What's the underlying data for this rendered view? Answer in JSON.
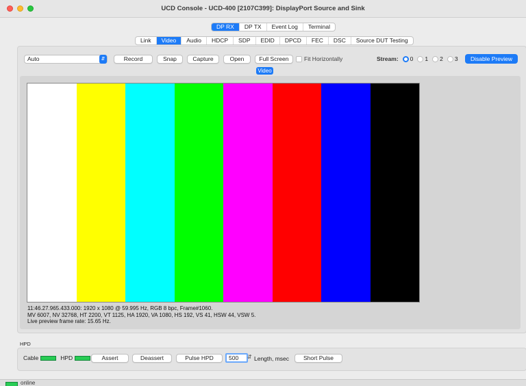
{
  "window": {
    "title": "UCD Console - UCD-400 [2107C399]: DisplayPort Source and Sink"
  },
  "top_tabs": [
    {
      "label": "DP RX",
      "active": true
    },
    {
      "label": "DP TX",
      "active": false
    },
    {
      "label": "Event Log",
      "active": false
    },
    {
      "label": "Terminal",
      "active": false
    }
  ],
  "sub_tabs": [
    {
      "label": "Link",
      "active": false
    },
    {
      "label": "Video",
      "active": true
    },
    {
      "label": "Audio",
      "active": false
    },
    {
      "label": "HDCP",
      "active": false
    },
    {
      "label": "SDP",
      "active": false
    },
    {
      "label": "EDID",
      "active": false
    },
    {
      "label": "DPCD",
      "active": false
    },
    {
      "label": "FEC",
      "active": false
    },
    {
      "label": "DSC",
      "active": false
    },
    {
      "label": "Source DUT Testing",
      "active": false
    }
  ],
  "toolbar": {
    "mode_select": "Auto",
    "record": "Record",
    "snap": "Snap",
    "capture": "Capture",
    "open": "Open",
    "full_screen": "Full Screen",
    "fit_horizontally": "Fit Horizontally",
    "stream_label": "Stream:",
    "stream_options": [
      "0",
      "1",
      "2",
      "3"
    ],
    "stream_selected": "0",
    "disable_preview": "Disable Preview"
  },
  "video": {
    "label": "Video",
    "bars": [
      "#ffffff",
      "#ffff00",
      "#00ffff",
      "#00ff00",
      "#ff00ff",
      "#ff0000",
      "#0000ff",
      "#000000"
    ],
    "info_line1": "11:46.27.965.433.000: 1920 x 1080 @ 59.995 Hz, RGB 8 bpc, Frame#1060.",
    "info_line2": "MV 6007, NV 32768, HT 2200, VT 1125, HA 1920, VA 1080, HS 192, VS 41, HSW 44, VSW 5.",
    "info_line3": "Live preview frame rate: 15.65 Hz."
  },
  "hpd": {
    "title": "HPD",
    "cable_label": "Cable",
    "hpd_label": "HPD",
    "assert": "Assert",
    "deassert": "Deassert",
    "pulse_hpd": "Pulse HPD",
    "length_value": "500",
    "length_label": "Length, msec",
    "short_pulse": "Short Pulse"
  },
  "status": {
    "text": "online"
  },
  "colors": {
    "accent": "#1d7bf7",
    "led_green": "#29cc55"
  }
}
